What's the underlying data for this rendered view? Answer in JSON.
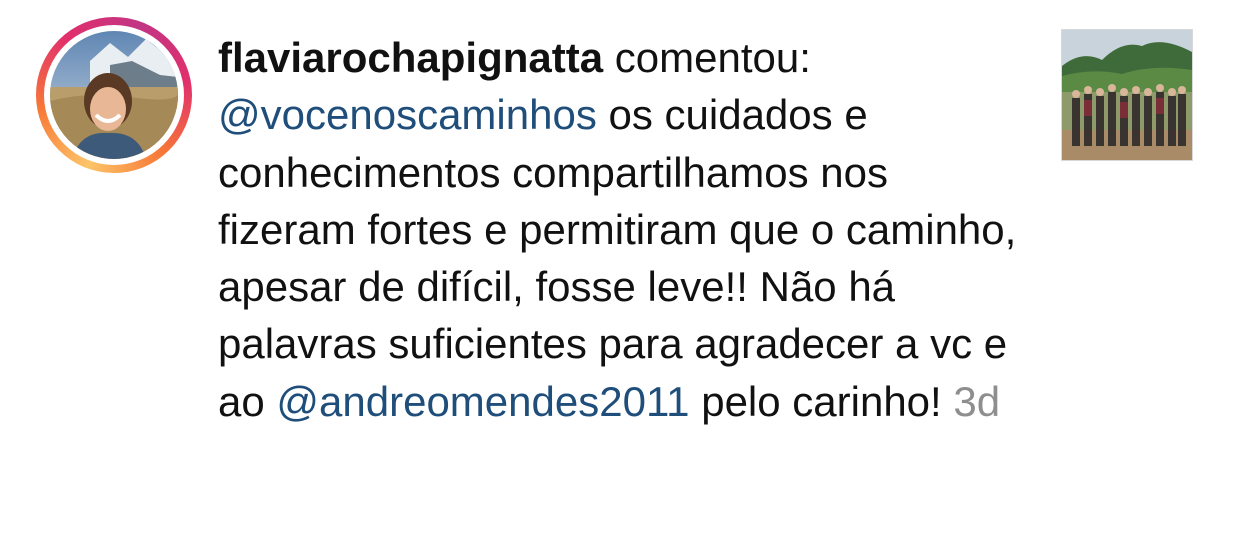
{
  "comment": {
    "username": "flaviarochapignatta",
    "action": "comentou:",
    "mention_1": "@vocenoscaminhos",
    "text_1": "os cuidados e conhecimentos compartilhamos nos fizeram fortes e permitiram que o caminho, apesar de difícil, fosse leve!! Não há palavras suficientes para agradecer a vc e ao",
    "mention_2": "@andreomendes2011",
    "text_2": "pelo carinho!",
    "timestamp": "3d"
  },
  "icons": {
    "avatar": "profile-photo",
    "post_thumbnail": "group-hike-photo"
  },
  "colors": {
    "mention": "#1f4e7a",
    "timestamp": "#8e8e8e",
    "text": "#111111",
    "story_ring": [
      "#fdc468",
      "#f77737",
      "#e1306c",
      "#c13584"
    ]
  }
}
